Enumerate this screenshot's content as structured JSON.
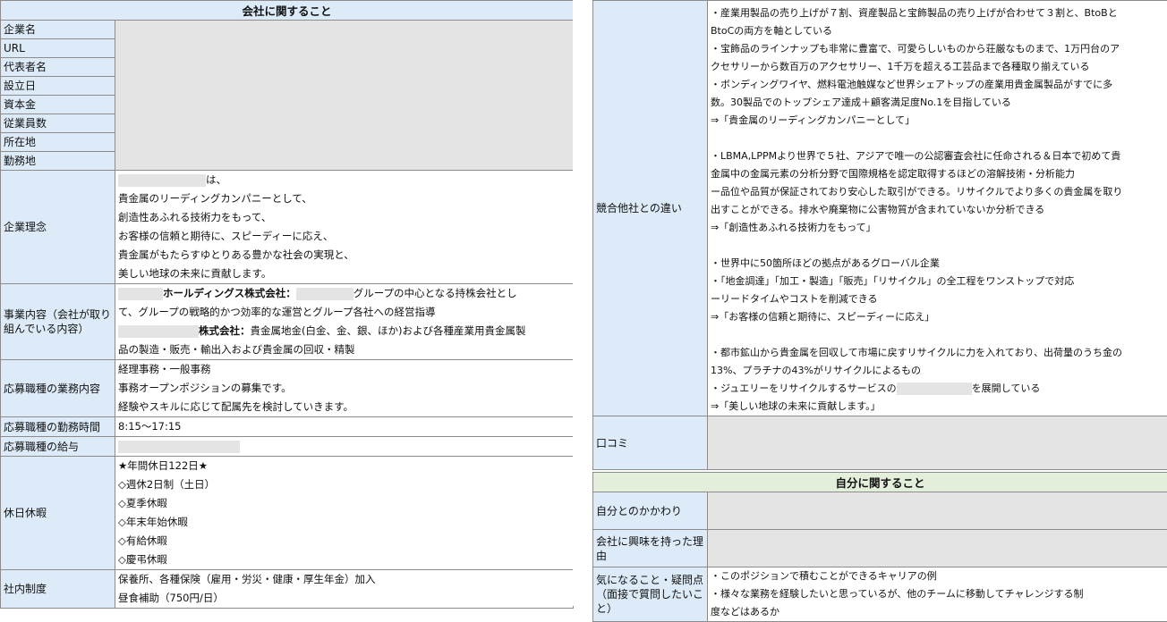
{
  "company_section": {
    "title": "会社に関すること",
    "fields": {
      "name": "企業名",
      "url": "URL",
      "ceo": "代表者名",
      "founded": "設立日",
      "capital": "資本金",
      "employees": "従業員数",
      "address": "所在地",
      "workplace": "勤務地"
    },
    "philosophy": {
      "label": "企業理念",
      "lines": [
        "は、",
        "貴金属のリーディングカンパニーとして、",
        "創造性あふれる技術力をもって、",
        "お客様の信頼と期待に、スピーディーに応え、",
        "貴金属がもたらすゆとりある豊かな社会の実現と、",
        "美しい地球の未来に貢献します。"
      ]
    },
    "business": {
      "label": "事業内容（会社が取り組んでいる内容）",
      "line1_bold": "ホールディングス株式会社：",
      "line1_rest": "グループの中心となる持株会社とし",
      "line2": "て、グループの戦略的かつ効率的な運営とグループ各社への経営指導",
      "line3_bold": "株式会社：",
      "line3_rest": "貴金属地金(白金、金、銀、ほか)および各種産業用貴金属製",
      "line4": "品の製造・販売・輸出入および貴金属の回収・精製"
    },
    "job": {
      "label": "応募職種の業務内容",
      "lines": [
        "経理事務・一般事務",
        "事務オープンポジションの募集です。",
        "経験やスキルに応じて配属先を検討していきます。"
      ]
    },
    "hours": {
      "label": "応募職種の勤務時間",
      "value": "8:15～17:15"
    },
    "salary": {
      "label": "応募職種の給与"
    },
    "holidays": {
      "label": "休日休暇",
      "lines": [
        "★年間休日122日★",
        "◇週休2日制（土日）",
        "◇夏季休暇",
        "◇年末年始休暇",
        "◇有給休暇",
        "◇慶弔休暇"
      ]
    },
    "system": {
      "label": "社内制度",
      "lines": [
        "保養所、各種保険（雇用・労災・健康・厚生年金）加入",
        "昼食補助（750円/日）"
      ]
    }
  },
  "competitor": {
    "label": "競合他社との違い",
    "lines": [
      "・産業用製品の売り上げが７割、資産製品と宝飾製品の売り上げが合わせて３割と、BtoBと",
      "BtoCの両方を軸としている",
      "・宝飾品のラインナップも非常に豊富で、可愛らしいものから荘厳なものまで、1万円台のア",
      "クセサリーから数百万のアクセサリー、1千万を超える工芸品まで各種取り揃えている",
      "・ボンディングワイヤ、燃料電池触媒など世界シェアトップの産業用貴金属製品がすでに多",
      "数。30製品でのトップシェア達成＋顧客満足度No.1を目指している",
      "⇒「貴金属のリーディングカンパニーとして」",
      "",
      "・LBMA,LPPMより世界で５社、アジアで唯一の公認審査会社に任命される＆日本で初めて貴",
      "金属中の金属元素の分析分野で国際規格を認定取得するほどの溶解技術・分析能力",
      "ー品位や品質が保証されており安心した取引ができる。リサイクルでより多くの貴金属を取り",
      "出すことができる。排水や廃棄物に公害物質が含まれていないか分析できる",
      "⇒「創造性あふれる技術力をもって」",
      "",
      "・世界中に50箇所ほどの拠点があるグローバル企業",
      "・「地金調達」「加工・製造」「販売」「リサイクル」の全工程をワンストップで対応",
      "ーリードタイムやコストを削減できる",
      "⇒「お客様の信頼と期待に、スピーディーに応え」",
      "",
      "・都市鉱山から貴金属を回収して市場に戻すリサイクルに力を入れており、出荷量のうち金の",
      "13%、プラチナの43%がリサイクルによるもの"
    ],
    "jewelry_prefix": "・ジュエリーをリサイクルするサービスの",
    "jewelry_suffix": "を展開している",
    "last_line": "⇒「美しい地球の未来に貢献します。」"
  },
  "reviews": {
    "label": "口コミ"
  },
  "self_section": {
    "title": "自分に関すること",
    "connection": "自分とのかかわり",
    "interest": "会社に興味を持った理由",
    "questions": {
      "label": "気になること・疑問点（面接で質問したいこと）",
      "lines": [
        "・このポジションで積むことができるキャリアの例",
        "・様々な業務を経験したいと思っているが、他のチームに移動してチャレンジする制",
        "度などはあるか"
      ]
    }
  }
}
